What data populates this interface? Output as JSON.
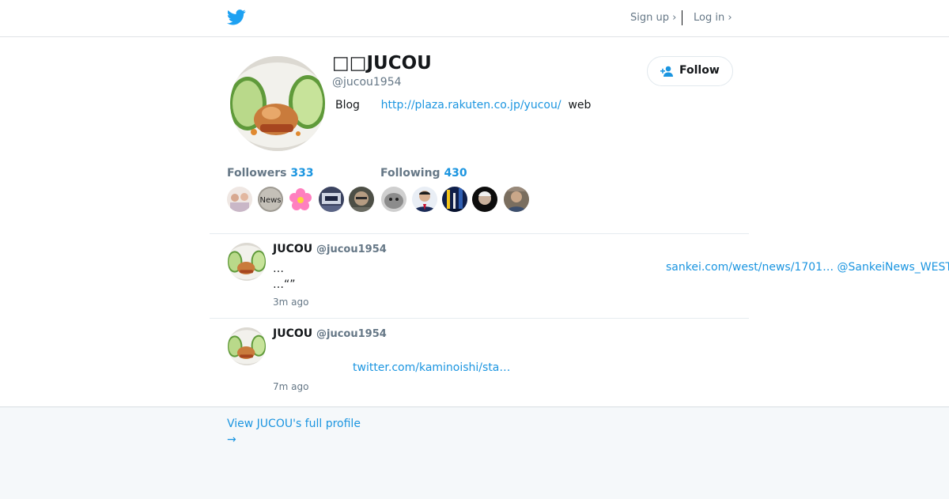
{
  "header": {
    "logo_icon": "twitter-bird-icon",
    "signup_label": "Sign up ›",
    "login_label": "Log in ›"
  },
  "profile": {
    "display_name": "□□JUCOU",
    "handle": "@jucou1954",
    "bio_prefix": "Blog",
    "bio_link": "http://plaza.rakuten.co.jp/yucou/",
    "bio_suffix": "web",
    "follow_label": "Follow",
    "follow_icon": "add-person-icon"
  },
  "stats": {
    "followers_label": "Followers",
    "followers_count": "333",
    "following_label": "Following",
    "following_count": "430"
  },
  "follower_avatars": [
    {
      "icon": "group-photo-avatar"
    },
    {
      "icon": "news-logo-avatar",
      "text": "News"
    },
    {
      "icon": "pink-flower-avatar"
    },
    {
      "icon": "building-avatar"
    },
    {
      "icon": "portrait-avatar"
    }
  ],
  "following_avatars": [
    {
      "icon": "cat-avatar"
    },
    {
      "icon": "man-in-suit-avatar"
    },
    {
      "icon": "night-city-avatar"
    },
    {
      "icon": "portrait-dark-avatar"
    },
    {
      "icon": "portrait-avatar"
    }
  ],
  "tweets": [
    {
      "name": "JUCOU",
      "handle": "@jucou1954",
      "text": "…\n…“”",
      "link": "sankei.com/west/news/1701…",
      "mention": "@SankeiNews_WEST",
      "time": "3m ago"
    },
    {
      "name": "JUCOU",
      "handle": "@jucou1954",
      "link": "twitter.com/kaminoishi/sta…",
      "time": "7m ago"
    }
  ],
  "footer": {
    "view_profile_label": "View JUCOU's full profile",
    "arrow": "→"
  },
  "colors": {
    "accent": "#1b95e0",
    "twitter_blue": "#1da1f2",
    "muted": "#657786",
    "footer_bg": "#f5f8fa"
  }
}
